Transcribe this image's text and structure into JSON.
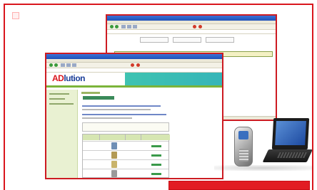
{
  "colors": {
    "frame": "#d9161d",
    "bottom_bar": "#e21c23",
    "xp_titlebar": "#2a60c9",
    "teal_band": "#3fc3b1",
    "nav_green": "#e9f1d2",
    "logo_blue": "#1c3f99",
    "logo_red": "#d9161d"
  },
  "front_window": {
    "logo": {
      "prefix": "AD",
      "rest": "lution"
    }
  },
  "icons": [
    "mobile-phone-icon",
    "laptop-computer-icon"
  ]
}
